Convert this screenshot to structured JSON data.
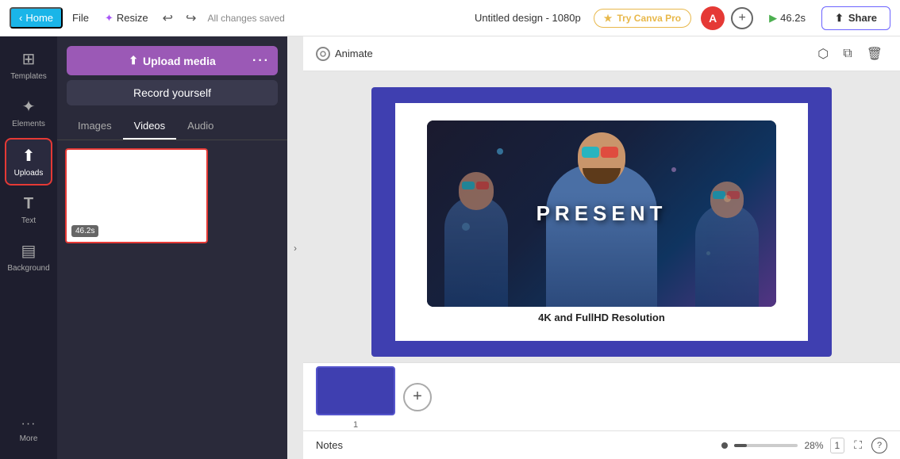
{
  "topbar": {
    "home_label": "Home",
    "file_label": "File",
    "resize_label": "Resize",
    "saved_text": "All changes saved",
    "title": "Untitled design - 1080p",
    "canvapro_label": "Try Canva Pro",
    "avatar_letter": "A",
    "timer_value": "46.2s",
    "share_label": "Share"
  },
  "left_nav": {
    "items": [
      {
        "id": "templates",
        "label": "Templates",
        "icon": "⊞"
      },
      {
        "id": "elements",
        "label": "Elements",
        "icon": "✦"
      },
      {
        "id": "uploads",
        "label": "Uploads",
        "icon": "⬆",
        "active": true
      },
      {
        "id": "text",
        "label": "Text",
        "icon": "T"
      },
      {
        "id": "background",
        "label": "Background",
        "icon": "▤"
      },
      {
        "id": "more",
        "label": "More",
        "icon": "···"
      }
    ]
  },
  "panel": {
    "upload_btn_label": "Upload media",
    "upload_dots": "···",
    "record_btn_label": "Record yourself",
    "tabs": [
      {
        "id": "images",
        "label": "Images",
        "active": false
      },
      {
        "id": "videos",
        "label": "Videos",
        "active": true
      },
      {
        "id": "audio",
        "label": "Audio",
        "active": false
      }
    ],
    "video_duration": "46.2s"
  },
  "canvas_toolbar": {
    "animate_label": "Animate",
    "icons": [
      "external-link",
      "copy",
      "trash"
    ]
  },
  "slide": {
    "caption_text": "4K and FullHD Resolution",
    "caption_bold": "FullHD",
    "overlay_text": "PRESENT"
  },
  "filmstrip": {
    "slide_num": "1",
    "add_label": "+"
  },
  "notes_bar": {
    "notes_label": "Notes",
    "zoom_percent": "28%",
    "page_indicator": "1"
  }
}
